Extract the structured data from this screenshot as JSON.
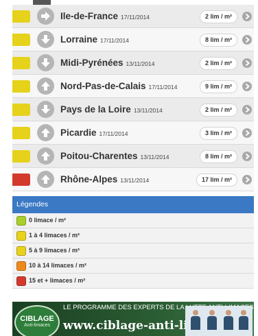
{
  "regions": [
    {
      "name": "Ile-de-France",
      "date": "17/11/2014",
      "value": "2 lim / m²",
      "color": "#e6d21a",
      "trend": "right"
    },
    {
      "name": "Lorraine",
      "date": "17/11/2014",
      "value": "8 lim / m²",
      "color": "#e6d21a",
      "trend": "down"
    },
    {
      "name": "Midi-Pyrénées",
      "date": "13/11/2014",
      "value": "2 lim / m²",
      "color": "#e6d21a",
      "trend": "down"
    },
    {
      "name": "Nord-Pas-de-Calais",
      "date": "17/11/2014",
      "value": "9 lim / m²",
      "color": "#e6d21a",
      "trend": "up"
    },
    {
      "name": "Pays de la Loire",
      "date": "13/11/2014",
      "value": "2 lim / m²",
      "color": "#e6d21a",
      "trend": "down"
    },
    {
      "name": "Picardie",
      "date": "17/11/2014",
      "value": "3 lim / m²",
      "color": "#e6d21a",
      "trend": "up"
    },
    {
      "name": "Poitou-Charentes",
      "date": "13/11/2014",
      "value": "8 lim / m²",
      "color": "#e6d21a",
      "trend": "up"
    },
    {
      "name": "Rhône-Alpes",
      "date": "13/11/2014",
      "value": "17 lim / m²",
      "color": "#d33a2c",
      "trend": "up"
    }
  ],
  "legend": {
    "title": "Légendes",
    "items": [
      {
        "label": "0 limace / m²",
        "color": "#a8cf2a"
      },
      {
        "label": "1 à 4 limaces / m²",
        "color": "#e8d21c"
      },
      {
        "label": "5 à 9 limaces / m²",
        "color": "#e8d21c"
      },
      {
        "label": "10 à 14 limaces / m²",
        "color": "#ee8a1c"
      },
      {
        "label": "15 et + limaces / m²",
        "color": "#d33a2c"
      }
    ]
  },
  "banner": {
    "tagline": "LE PROGRAMME DES EXPERTS DE LA LUTTE ANTI-LIMACES",
    "url": "www.ciblage-anti-limaces.fr",
    "logo_title": "CIBLAGE",
    "logo_subtitle": "Anti-limaces"
  }
}
